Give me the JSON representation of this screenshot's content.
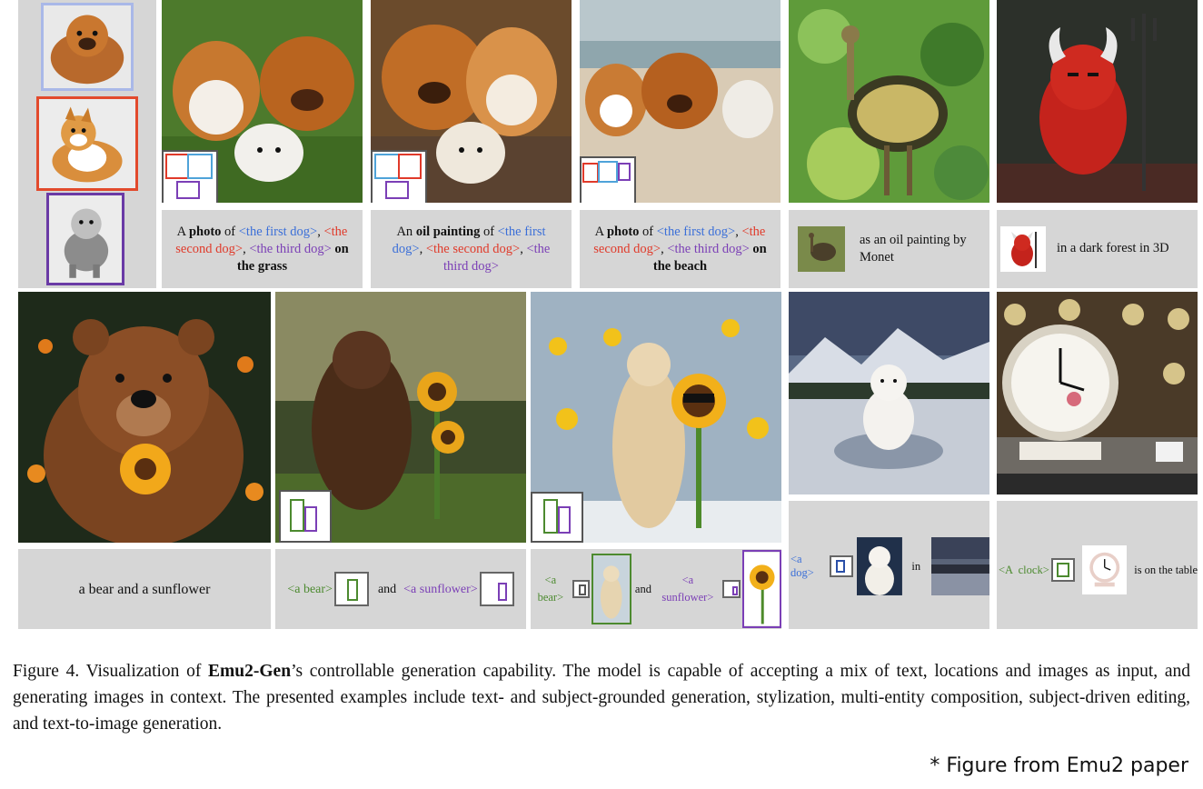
{
  "row1": {
    "cap1": {
      "pre": "A ",
      "bold1": "photo",
      "mid1": " of ",
      "e1": "<the first dog>",
      "c1": ",",
      "e2": "<the second dog>",
      "c2": ", ",
      "e3": "<the third dog>",
      "bold2": " on the grass"
    },
    "cap2": {
      "pre": "An ",
      "bold1": "oil painting",
      "mid1": " of ",
      "e1": "<the first dog>",
      "c1": ", ",
      "e2": "<the second dog>",
      "c2": ", ",
      "e3": "<the third dog>"
    },
    "cap3": {
      "pre": "A ",
      "bold1": "photo",
      "mid1": " of ",
      "e1": "<the first dog>",
      "c1": ",",
      "e2": "<the second dog>",
      "c2": ", ",
      "e3": "<the third dog>",
      "bold2": " on the beach"
    },
    "cap4": "as an oil painting by Monet",
    "cap5": "in a dark forest in 3D"
  },
  "row2": {
    "cap1": "a bear and  a sunflower",
    "cap2": {
      "e1": "<a bear>",
      "and": "and",
      "e2": "<a sunflower>"
    },
    "cap3": {
      "e1": "<a bear>",
      "and": "and",
      "e2": "<a sunflower>"
    },
    "cap4": {
      "e1": "<a dog>",
      "in": "in"
    },
    "cap5": {
      "e1": "<A  clock>",
      "tail": "is on the table"
    }
  },
  "figure": {
    "label": "Figure 4.",
    "pre": " Visualization of ",
    "bold": "Emu2-Gen",
    "post": "’s controllable generation capability. The model is capable of accepting a mix of text, locations and images as input, and generating images in context.  The presented examples include text- and subject-grounded generation, stylization, multi-entity composition, subject-driven editing, and text-to-image generation."
  },
  "credit": "* Figure from Emu2 paper",
  "colors": {
    "blue": "#3b6fd8",
    "red": "#e03a2a",
    "purple": "#7b3fb6",
    "green": "#4c8a2f",
    "panel": "#d6d6d6"
  }
}
